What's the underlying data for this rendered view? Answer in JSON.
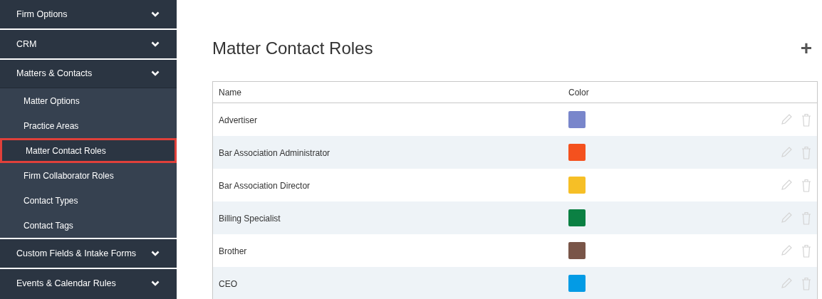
{
  "sidebar": {
    "sections": [
      {
        "label": "Firm Options",
        "expanded": false
      },
      {
        "label": "CRM",
        "expanded": false
      },
      {
        "label": "Matters & Contacts",
        "expanded": true,
        "children": [
          {
            "label": "Matter Options",
            "selected": false
          },
          {
            "label": "Practice Areas",
            "selected": false
          },
          {
            "label": "Matter Contact Roles",
            "selected": true
          },
          {
            "label": "Firm Collaborator Roles",
            "selected": false
          },
          {
            "label": "Contact Types",
            "selected": false
          },
          {
            "label": "Contact Tags",
            "selected": false
          }
        ]
      },
      {
        "label": "Custom Fields & Intake Forms",
        "expanded": false
      },
      {
        "label": "Events & Calendar Rules",
        "expanded": false
      }
    ]
  },
  "page": {
    "title": "Matter Contact Roles",
    "add_button": "+"
  },
  "table": {
    "columns": [
      "Name",
      "Color"
    ],
    "rows": [
      {
        "name": "Advertiser",
        "color": "#7986cb"
      },
      {
        "name": "Bar Association Administrator",
        "color": "#f4511e"
      },
      {
        "name": "Bar Association Director",
        "color": "#f6bf26"
      },
      {
        "name": "Billing Specialist",
        "color": "#0b8043"
      },
      {
        "name": "Brother",
        "color": "#795548"
      },
      {
        "name": "CEO",
        "color": "#039be5"
      }
    ]
  }
}
